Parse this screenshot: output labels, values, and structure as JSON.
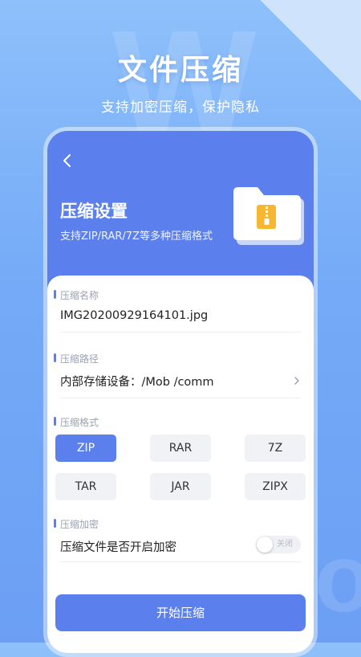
{
  "hero": {
    "title": "文件压缩",
    "subtitle": "支持加密压缩，保护隐私"
  },
  "screen": {
    "title": "压缩设置",
    "subtitle": "支持ZIP/RAR/7Z等多种压缩格式"
  },
  "name_section": {
    "label": "压缩名称",
    "value": "IMG20200929164101.jpg"
  },
  "path_section": {
    "label": "压缩路径",
    "value": "内部存储设备：/Mob /comm"
  },
  "format_section": {
    "label": "压缩格式",
    "options": [
      "ZIP",
      "RAR",
      "7Z",
      "TAR",
      "JAR",
      "ZIPX"
    ],
    "selected": "ZIP"
  },
  "encrypt_section": {
    "label": "压缩加密",
    "question": "压缩文件是否开启加密",
    "toggle_label": "关闭",
    "enabled": false
  },
  "actions": {
    "start_label": "开始压缩"
  },
  "colors": {
    "accent": "#5b80ee",
    "folder_badge": "#f7b733"
  }
}
